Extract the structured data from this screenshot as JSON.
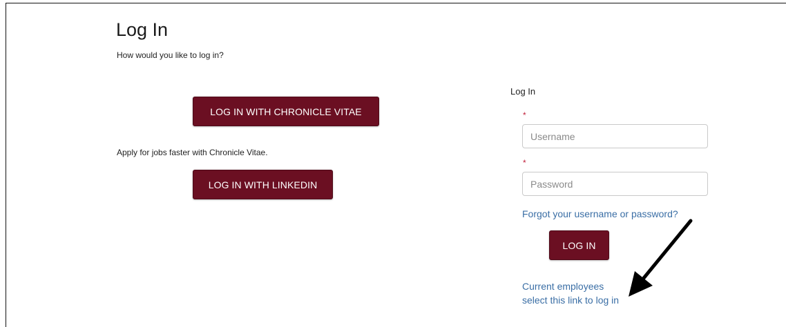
{
  "page": {
    "title": "Log In",
    "subtitle": "How would you like to log in?"
  },
  "external_login": {
    "vitae_button": "LOG IN WITH CHRONICLE VITAE",
    "apply_text": "Apply for jobs faster with Chronicle Vitae.",
    "linkedin_button": "LOG IN WITH LINKEDIN"
  },
  "login_form": {
    "heading": "Log In",
    "required_marker": "*",
    "username_placeholder": "Username",
    "username_value": "",
    "password_placeholder": "Password",
    "password_value": "",
    "forgot_link": "Forgot your username or password?",
    "submit_button": "LOG IN",
    "employees_link_line1": "Current employees",
    "employees_link_line2": "select this link to log in"
  },
  "annotation": {
    "arrow_icon": "arrow-pointing-down-left-icon",
    "arrow_color": "#000000"
  },
  "colors": {
    "button_bg": "#6b0f22",
    "link": "#3a6ea5",
    "required": "#c0203a"
  }
}
